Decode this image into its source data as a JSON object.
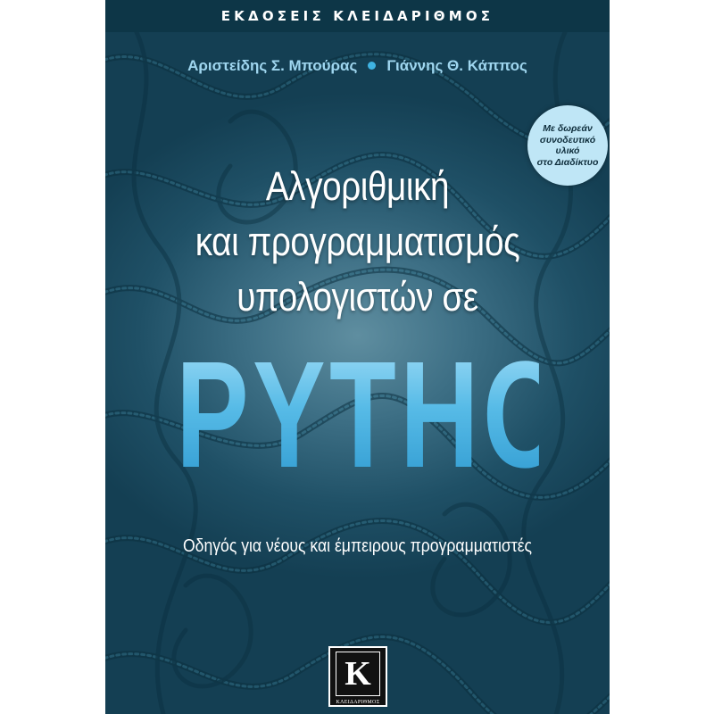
{
  "cover": {
    "publisher": "ΕΚΔΟΣΕΙΣ ΚΛΕΙΔΑΡΙΘΜΟΣ",
    "authors": [
      "Αριστείδης Σ. Μπούρας",
      "Γιάννης Θ. Κάππος"
    ],
    "badge_lines": [
      "Με δωρεάν",
      "συνοδευτικό",
      "υλικό",
      "στο Διαδίκτυο"
    ],
    "title_lines": [
      "Αλγοριθμική",
      "και προγραμματισμός",
      "υπολογιστών σε"
    ],
    "big_word": "PYTHON",
    "subtitle": "Οδηγός για νέους και έμπειρους προγραμματιστές",
    "logo": {
      "letter": "K",
      "text": "ΚΛΕΙΔΑΡΙΘΜΟΣ"
    }
  },
  "colors": {
    "background_dark": "#143f53",
    "background_light": "#5f8ea0",
    "accent_blue": "#54b8e6",
    "author_text": "#9fd6ef",
    "badge_fill": "#bfe6f6"
  },
  "icons": [
    "snake-pattern-background",
    "publisher-logo-icon",
    "bullet-dot-icon"
  ]
}
